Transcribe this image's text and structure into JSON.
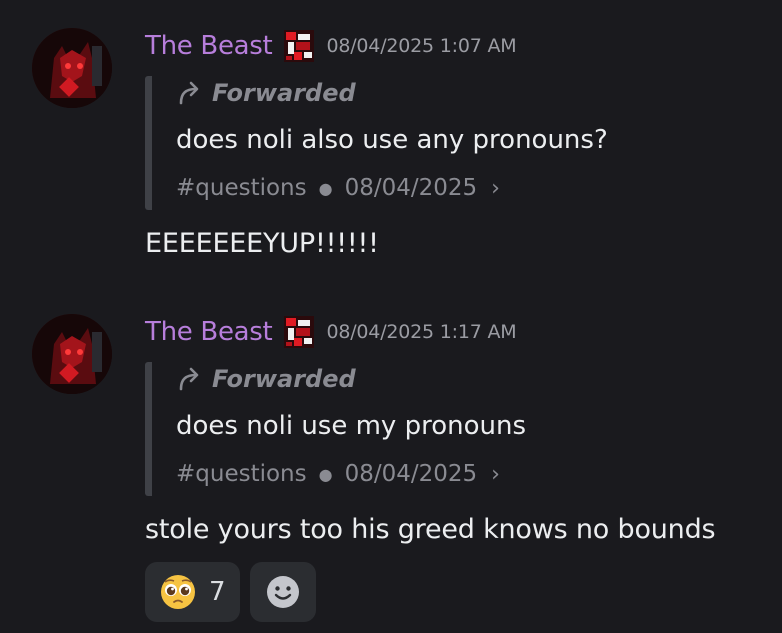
{
  "colors": {
    "background": "#1a1a1e",
    "username": "#b77edb",
    "muted": "#8a8b92",
    "text": "#eceef0",
    "reaction_bg": "#2b2d31"
  },
  "messages": [
    {
      "author": "The Beast",
      "avatar_icon": "demon-avatar-icon",
      "badge_icon": "glitch-badge-icon",
      "timestamp": "08/04/2025 1:07 AM",
      "forwarded_label": "Forwarded",
      "quoted_text": "does noli also use any pronouns?",
      "source_channel": "#questions",
      "source_date": "08/04/2025",
      "reply": "EEEEEEEYUP!!!!!!"
    },
    {
      "author": "The Beast",
      "avatar_icon": "demon-avatar-icon",
      "badge_icon": "glitch-badge-icon",
      "timestamp": "08/04/2025 1:17 AM",
      "forwarded_label": "Forwarded",
      "quoted_text": "does noli use my pronouns",
      "source_channel": "#questions",
      "source_date": "08/04/2025",
      "reply": "stole yours too his greed knows no bounds"
    }
  ],
  "reactions": [
    {
      "emoji_icon": "pleading-face-icon",
      "count": "7"
    }
  ],
  "add_reaction_icon": "smiley-add-reaction-icon"
}
